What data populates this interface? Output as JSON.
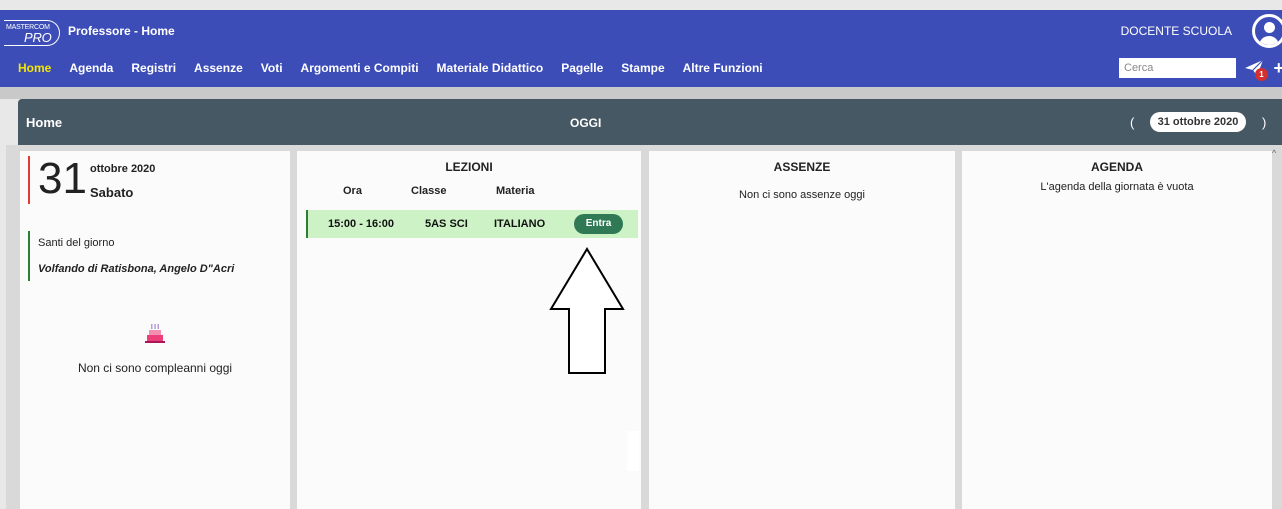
{
  "header": {
    "logo_top": "MASTERCOM",
    "logo_bottom": "PRO",
    "title": "Professore - Home",
    "user": "DOCENTE SCUOLA",
    "search_placeholder": "Cerca",
    "notification_count": "1",
    "plus": "+"
  },
  "nav": [
    "Home",
    "Agenda",
    "Registri",
    "Assenze",
    "Voti",
    "Argomenti e Compiti",
    "Materiale Didattico",
    "Pagelle",
    "Stampe",
    "Altre Funzioni"
  ],
  "section": {
    "title": "Home",
    "center_label": "OGGI",
    "date": "31 ottobre 2020",
    "prev": "(",
    "next": ")"
  },
  "today": {
    "day": "31",
    "month_year": "ottobre 2020",
    "weekday": "Sabato",
    "saints_label": "Santi del giorno",
    "saints": "Volfando di Ratisbona, Angelo D\"Acri",
    "birthdays_msg": "Non ci sono compleanni oggi"
  },
  "lessons": {
    "title": "LEZIONI",
    "columns": [
      "Ora",
      "Classe",
      "Materia"
    ],
    "rows": [
      {
        "time": "15:00 - 16:00",
        "class": "5AS SCI",
        "subject": "ITALIANO",
        "action": "Entra"
      }
    ]
  },
  "absences": {
    "title": "ASSENZE",
    "message": "Non ci sono assenze oggi"
  },
  "agenda": {
    "title": "AGENDA",
    "message": "L'agenda della giornata è vuota"
  },
  "colors": {
    "topbar": "#3d4db7",
    "section_bar": "#475865",
    "active_nav": "#f5e600",
    "lesson_row": "#cdf2c5",
    "enter_button": "#2f7a55"
  }
}
